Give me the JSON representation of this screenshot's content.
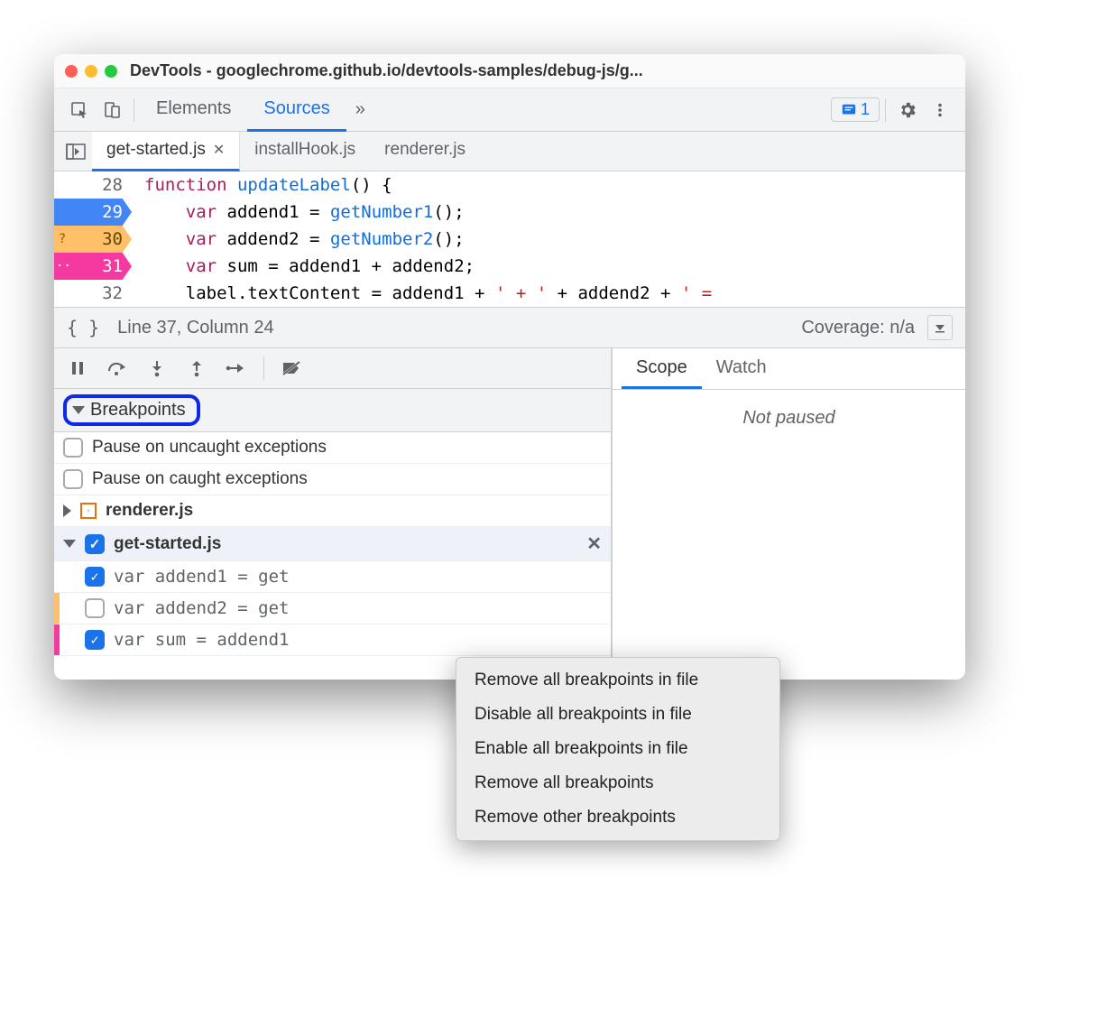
{
  "window": {
    "title": "DevTools - googlechrome.github.io/devtools-samples/debug-js/g..."
  },
  "topbar": {
    "tabs": [
      "Elements",
      "Sources"
    ],
    "active": "Sources",
    "issues_count": "1"
  },
  "filetabs": {
    "items": [
      {
        "name": "get-started.js",
        "active": true,
        "closable": true
      },
      {
        "name": "installHook.js",
        "active": false,
        "closable": false
      },
      {
        "name": "renderer.js",
        "active": false,
        "closable": false
      }
    ]
  },
  "editor": {
    "lines": [
      {
        "num": "28",
        "marker": "",
        "text": "function updateLabel() {"
      },
      {
        "num": "29",
        "marker": "blue",
        "text": "    var addend1 = getNumber1();"
      },
      {
        "num": "30",
        "marker": "orange",
        "badge": "?",
        "text": "    var addend2 = getNumber2();"
      },
      {
        "num": "31",
        "marker": "pink",
        "badge": "··",
        "text": "    var sum = addend1 + addend2;"
      },
      {
        "num": "32",
        "marker": "",
        "text": "    label.textContent = addend1 + ' + ' + addend2 + ' ="
      }
    ]
  },
  "status": {
    "cursor": "Line 37, Column 24",
    "coverage": "Coverage: n/a"
  },
  "rightpanel": {
    "tabs": [
      "Scope",
      "Watch"
    ],
    "active": "Scope",
    "message": "Not paused"
  },
  "breakpoints": {
    "section_label": "Breakpoints",
    "pause_uncaught": "Pause on uncaught exceptions",
    "pause_caught": "Pause on caught exceptions",
    "groups": [
      {
        "file": "renderer.js",
        "expanded": false,
        "checked": false,
        "showCheckbox": false,
        "items": []
      },
      {
        "file": "get-started.js",
        "expanded": true,
        "checked": true,
        "showCheckbox": true,
        "closable": true,
        "items": [
          {
            "checked": true,
            "stripe": "",
            "text": "var addend1 = get"
          },
          {
            "checked": false,
            "stripe": "#ffc069",
            "text": "var addend2 = get"
          },
          {
            "checked": true,
            "stripe": "#f439a0",
            "text": "var sum = addend1"
          }
        ]
      }
    ]
  },
  "contextmenu": {
    "items": [
      "Remove all breakpoints in file",
      "Disable all breakpoints in file",
      "Enable all breakpoints in file",
      "Remove all breakpoints",
      "Remove other breakpoints"
    ]
  }
}
